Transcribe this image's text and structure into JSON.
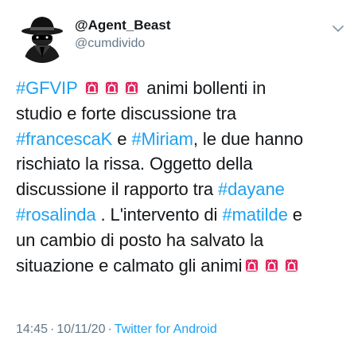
{
  "author": {
    "display_name": "@Agent_Beast",
    "handle": "@cumdivido",
    "avatar_icon": "spy-agent-icon"
  },
  "menu_icon": "chevron-down-icon",
  "tweet": {
    "line1": {
      "hashtag": "#GFVIP",
      "text": " animi bollenti in"
    },
    "line2": {
      "text": "studio e forte discussione tra"
    },
    "line3": {
      "hashtag1": "#francescaK",
      "mid": " e ",
      "hashtag2": "#Miriam",
      "text": ", le due hanno"
    },
    "line4": {
      "text": "rischiato la rissa. Oggetto della"
    },
    "line5": {
      "text": "discussione il rapporto tra ",
      "hashtag": "#dayane"
    },
    "line6": {
      "hashtag": "#rosalinda",
      "mid": " . L'intervento di ",
      "hashtag2": "#matilde",
      "text": " e"
    },
    "line7": {
      "text": "un cambio di posto ha salvato la"
    },
    "line8": {
      "text": "situazione e calmato gli animi"
    },
    "emoji_icon": "police-siren-icon"
  },
  "meta": {
    "time": "14:45",
    "separator": "·",
    "date": "10/11/20",
    "source": "Twitter for Android"
  },
  "colors": {
    "link": "#1da1f2",
    "secondary_text": "#657786",
    "primary_text": "#14171a",
    "siren_red": "#e0245e"
  }
}
